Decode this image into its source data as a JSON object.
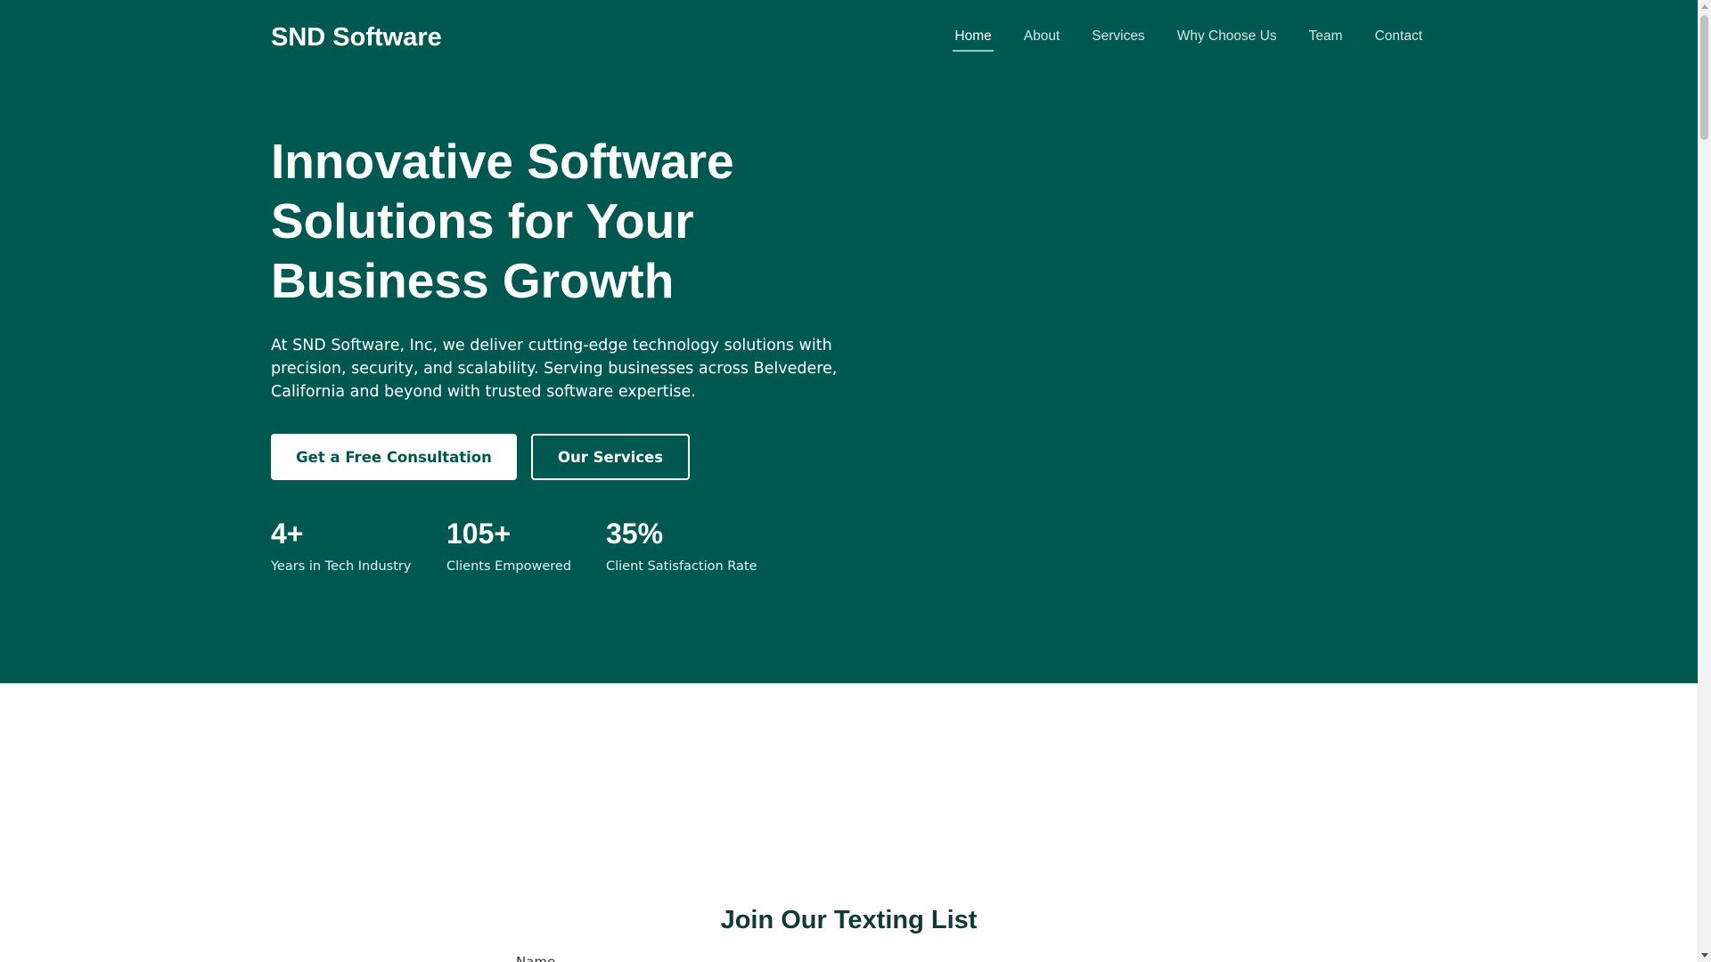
{
  "header": {
    "brand": "SND Software",
    "nav": [
      {
        "label": "Home",
        "active": true
      },
      {
        "label": "About",
        "active": false
      },
      {
        "label": "Services",
        "active": false
      },
      {
        "label": "Why Choose Us",
        "active": false
      },
      {
        "label": "Team",
        "active": false
      },
      {
        "label": "Contact",
        "active": false
      }
    ]
  },
  "hero": {
    "title": "Innovative Software Solutions for Your Business Growth",
    "description": "At SND Software, Inc, we deliver cutting-edge technology solutions with precision, security, and scalability. Serving businesses across Belvedere, California and beyond with trusted software expertise.",
    "primary_button": "Get a Free Consultation",
    "secondary_button": "Our Services",
    "stats": [
      {
        "value": "4+",
        "label": "Years in Tech Industry"
      },
      {
        "value": "105+",
        "label": "Clients Empowered"
      },
      {
        "value": "35%",
        "label": "Client Satisfaction Rate"
      }
    ]
  },
  "texting_list": {
    "title": "Join Our Texting List",
    "name_label": "Name"
  },
  "colors": {
    "hero_bg": "#005951",
    "accent": "#7fd3bd",
    "primary_button_text": "#005951",
    "section_title": "#0f3b36"
  },
  "icons": {
    "scroll_up": "triangle-up-icon",
    "scroll_down": "triangle-down-icon"
  }
}
